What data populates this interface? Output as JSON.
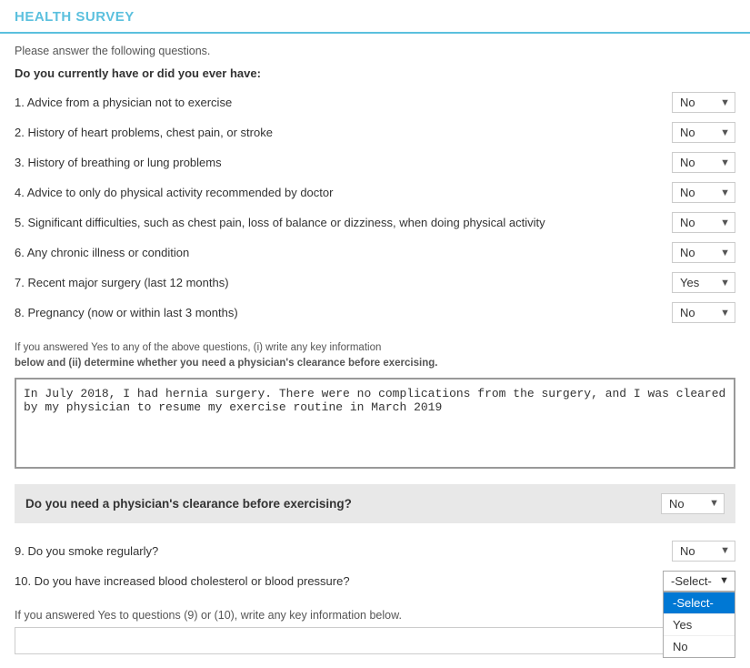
{
  "header": {
    "title": "HEALTH SURVEY"
  },
  "intro": {
    "text": "Please answer the following questions.",
    "section_label": "Do you currently have or did you ever have:"
  },
  "questions": [
    {
      "number": "1.",
      "text": "Advice from a physician not to exercise",
      "answer": "No"
    },
    {
      "number": "2.",
      "text": "History of heart problems, chest pain, or stroke",
      "answer": "No"
    },
    {
      "number": "3.",
      "text": "History of breathing or lung problems",
      "answer": "No"
    },
    {
      "number": "4.",
      "text": "Advice to only do physical activity recommended by doctor",
      "answer": "No"
    },
    {
      "number": "5.",
      "text": "Significant difficulties, such as chest pain, loss of balance or dizziness, when doing physical activity",
      "answer": "No"
    },
    {
      "number": "6.",
      "text": "Any chronic illness or condition",
      "answer": "No"
    },
    {
      "number": "7.",
      "text": "Recent major surgery (last 12 months)",
      "answer": "Yes"
    },
    {
      "number": "8.",
      "text": "Pregnancy (now or within last 3 months)",
      "answer": "No"
    }
  ],
  "yes_info": {
    "label_part1": "If you answered Yes to any of the above questions, (i) write any key information",
    "label_part2": "below and (ii) determine whether you need a physician's clearance before exercising.",
    "textarea_value": "In July 2018, I had hernia surgery. There were no complications from the surgery, and I was cleared by my physician to resume my exercise routine in March 2019"
  },
  "physician_clearance": {
    "label": "Do you need a physician's clearance before exercising?",
    "answer": "No"
  },
  "questions_bottom": [
    {
      "number": "9.",
      "text": "Do you smoke regularly?",
      "answer": "No"
    },
    {
      "number": "10.",
      "text": "Do you have increased blood cholesterol or blood pressure?",
      "answer": "-Select-"
    }
  ],
  "dropdown_open": {
    "options": [
      "-Select-",
      "Yes",
      "No"
    ],
    "selected": "-Select-"
  },
  "bottom_note": "If you answered Yes to questions (9) or (10), write any key information below.",
  "options": [
    "No",
    "Yes"
  ],
  "select_options": [
    "-Select-",
    "Yes",
    "No"
  ]
}
